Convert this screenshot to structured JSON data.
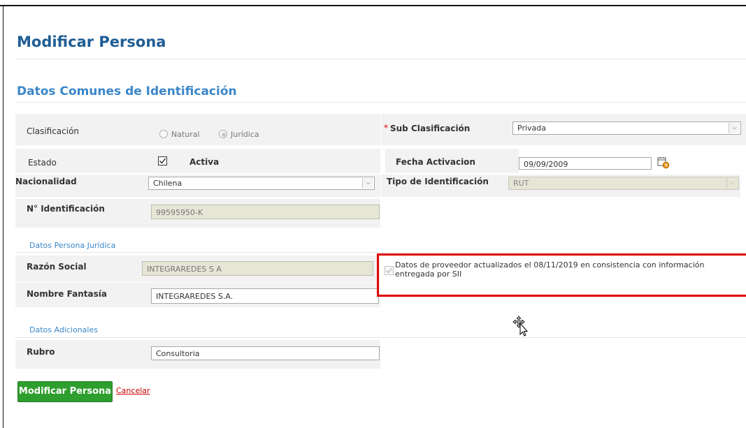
{
  "page": {
    "title": "Modificar Persona"
  },
  "section": {
    "title": "Datos Comunes de Identificación"
  },
  "clasificacion": {
    "label": "Clasificación",
    "options": [
      "Natural",
      "Jurídica"
    ],
    "selected": "Jurídica"
  },
  "sub_clasificacion": {
    "required_mark": "*",
    "label": "Sub Clasificación",
    "value": "Privada"
  },
  "estado": {
    "label": "Estado",
    "checked": true,
    "checkbox_label": "Activa"
  },
  "fecha_activacion": {
    "label": "Fecha Activacion",
    "value": "09/09/2009"
  },
  "nacionalidad": {
    "label": "Nacionalidad",
    "value": "Chilena"
  },
  "tipo_identificacion": {
    "label": "Tipo de Identificación",
    "value": "RUT"
  },
  "identificacion": {
    "label": "N° Identificación",
    "value": "99595950-K"
  },
  "juridica": {
    "title": "Datos Persona Jurídica",
    "razon_social_label": "Razón Social",
    "razon_social_value": "INTEGRAREDES S A",
    "nombre_fantasia_label": "Nombre Fantasía",
    "nombre_fantasia_value": "INTEGRAREDES S.A.",
    "sii_note": "Datos de proveedor actualizados el 08/11/2019 en consistencia con información entregada por SII"
  },
  "adicionales": {
    "title": "Datos Adicionales",
    "rubro_label": "Rubro",
    "rubro_value": "Consultoria"
  },
  "actions": {
    "submit_label": "Modificar Persona",
    "cancel_label": "Cancelar"
  },
  "colors": {
    "title": "#1f5d94",
    "section": "#3a86c8",
    "button": "#2e9e2e",
    "highlight": "#e00000",
    "cancel": "#cc0000"
  }
}
